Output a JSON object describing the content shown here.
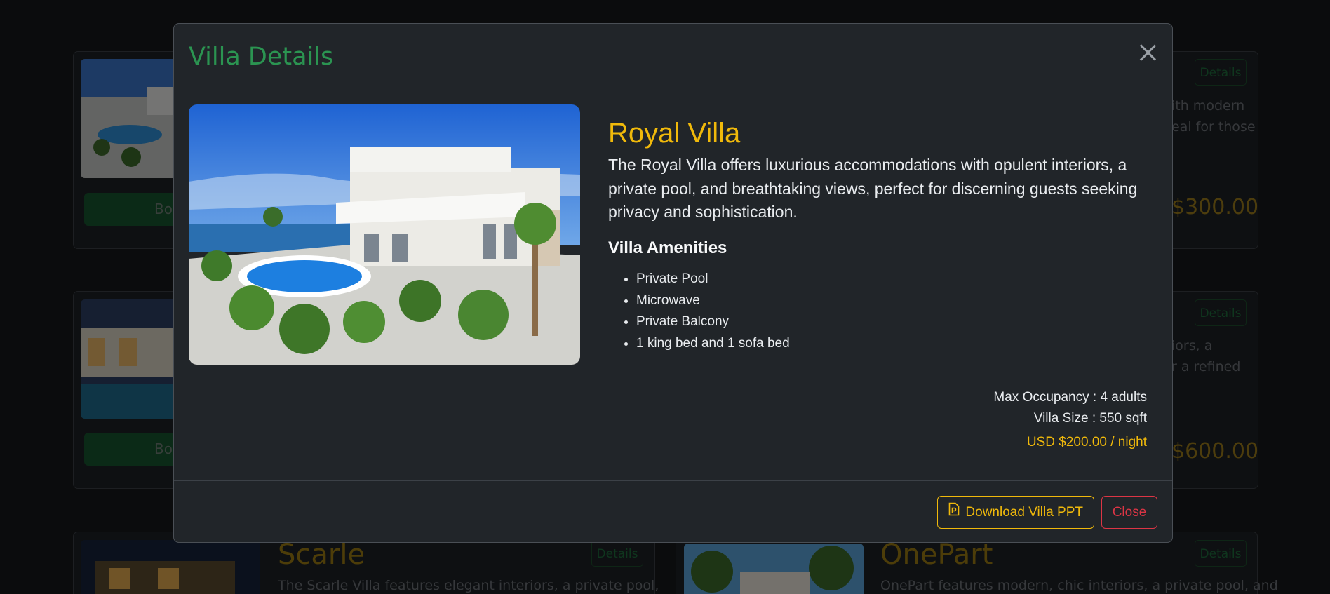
{
  "modal": {
    "title": "Villa Details",
    "villa_name": "Royal Villa",
    "description": "The Royal Villa offers luxurious accommodations with opulent interiors, a private pool, and breathtaking views, perfect for discerning guests seeking privacy and sophistication.",
    "amenities_title": "Villa Amenities",
    "amenities": [
      "Private Pool",
      "Microwave",
      "Private Balcony",
      "1 king bed and 1 sofa bed"
    ],
    "max_occupancy": "Max Occupancy : 4 adults",
    "villa_size": "Villa Size : 550 sqft",
    "price": "USD $200.00 / night",
    "download_label": "Download Villa PPT",
    "close_label": "Close",
    "icons": {
      "close": "close-icon",
      "download": "file-ppt-icon"
    }
  },
  "background": {
    "book_label": "Boo",
    "details_label": "Details",
    "card1": {
      "text_line1": "ith modern",
      "text_line2": "eal for those",
      "price": "$300.00"
    },
    "card2": {
      "text_line1": "iors, a",
      "text_line2": "r a refined",
      "price": "$600.00"
    },
    "card3": {
      "title": "Scarle",
      "text": "The Scarle Villa features elegant interiors, a private pool,"
    },
    "card4": {
      "title": "OnePart",
      "text": "OnePart features modern, chic interiors, a private pool, and"
    }
  },
  "colors": {
    "accent_green": "#2b9451",
    "accent_gold": "#f0b90b",
    "danger_red": "#dc3545",
    "modal_bg": "#212529"
  }
}
